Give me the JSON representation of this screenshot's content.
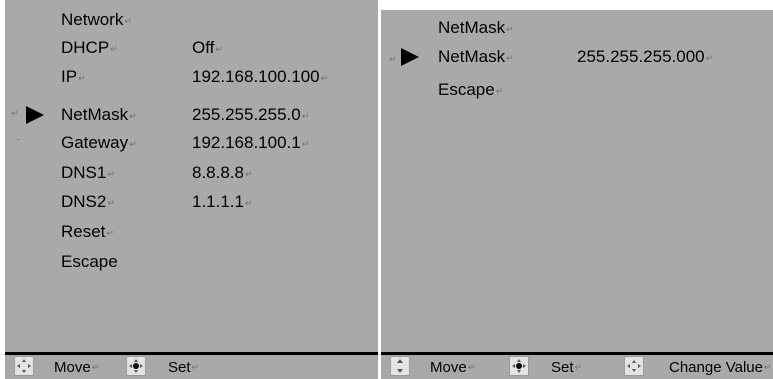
{
  "left_panel": {
    "title": "Network",
    "items": [
      {
        "label": "DHCP",
        "value": "Off"
      },
      {
        "label": "IP",
        "value": "192.168.100.100"
      },
      {
        "label": "NetMask",
        "value": "255.255.255.0"
      },
      {
        "label": "Gateway",
        "value": "192.168.100.1"
      },
      {
        "label": "DNS1",
        "value": "8.8.8.8"
      },
      {
        "label": "DNS2",
        "value": "1.1.1.1"
      },
      {
        "label": "Reset",
        "value": ""
      },
      {
        "label": "Escape",
        "value": ""
      }
    ],
    "selected_label": "NetMask",
    "footer": {
      "move_label": "Move",
      "set_label": "Set"
    }
  },
  "right_panel": {
    "title": "NetMask",
    "items": [
      {
        "label": "NetMask",
        "value": "255.255.255.000"
      },
      {
        "label": "Escape",
        "value": ""
      }
    ],
    "selected_label": "NetMask",
    "footer": {
      "move_label": "Move",
      "set_label": "Set",
      "change_label": "Change Value"
    }
  },
  "icons": {
    "cursor": "selection-arrow-icon",
    "move": "four-way-arrows-icon",
    "set": "center-dot-arrows-icon",
    "change": "up-down-arrows-icon"
  },
  "colors": {
    "panel_background": "#a9a9a9",
    "text": "#000000",
    "footer_rule": "#000000"
  }
}
